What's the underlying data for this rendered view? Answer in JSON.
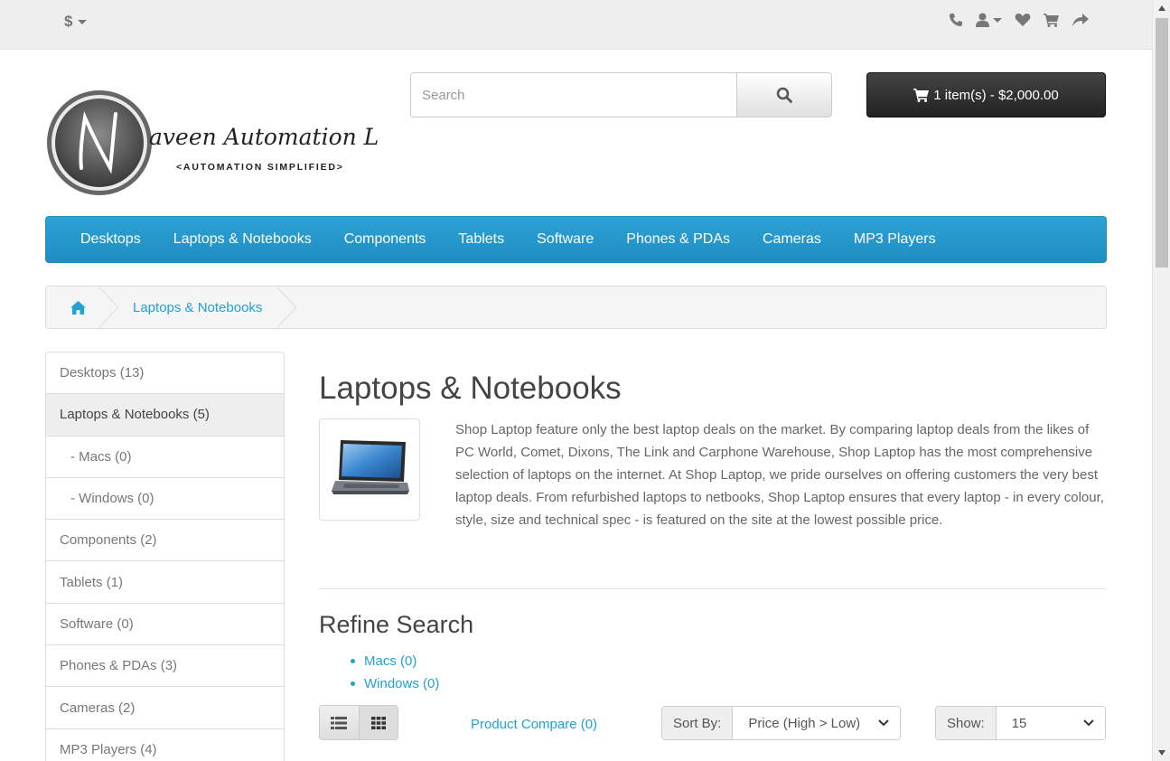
{
  "topbar": {
    "currency_symbol": "$",
    "icons": [
      "phone-icon",
      "user-icon",
      "heart-icon",
      "shopping-cart-icon",
      "share-icon"
    ]
  },
  "logo": {
    "initial": "N",
    "line1": "aveen Automation Labs",
    "line2": "<AUTOMATION SIMPLIFIED>"
  },
  "search": {
    "placeholder": "Search",
    "value": ""
  },
  "cart": {
    "label": "1 item(s) - $2,000.00"
  },
  "menu": {
    "items": [
      "Desktops",
      "Laptops & Notebooks",
      "Components",
      "Tablets",
      "Software",
      "Phones & PDAs",
      "Cameras",
      "MP3 Players"
    ]
  },
  "breadcrumb": {
    "current": "Laptops & Notebooks"
  },
  "sidebar": {
    "items": [
      {
        "label": "Desktops (13)"
      },
      {
        "label": "Laptops & Notebooks (5)"
      },
      {
        "label": "- Macs (0)"
      },
      {
        "label": "- Windows (0)"
      },
      {
        "label": "Components (2)"
      },
      {
        "label": "Tablets (1)"
      },
      {
        "label": "Software (0)"
      },
      {
        "label": "Phones & PDAs (3)"
      },
      {
        "label": "Cameras (2)"
      },
      {
        "label": "MP3 Players (4)"
      }
    ]
  },
  "content": {
    "title": "Laptops & Notebooks",
    "description": "Shop Laptop feature only the best laptop deals on the market. By comparing laptop deals from the likes of PC World, Comet, Dixons, The Link and Carphone Warehouse, Shop Laptop has the most comprehensive selection of laptops on the internet. At Shop Laptop, we pride ourselves on offering customers the very best laptop deals. From refurbished laptops to netbooks, Shop Laptop ensures that every laptop - in every colour, style, size and technical spec - is featured on the site at the lowest possible price.",
    "refine_title": "Refine Search",
    "refine_items": [
      "Macs (0)",
      "Windows (0)"
    ]
  },
  "toolbar": {
    "compare_label": "Product Compare (0)",
    "sort_label": "Sort By:",
    "sort_value": "Price (High > Low)",
    "show_label": "Show:",
    "show_value": "15"
  },
  "colors": {
    "menu_blue": "#229ac8",
    "link_blue": "#23a1d1",
    "cart_dark": "#303030"
  }
}
